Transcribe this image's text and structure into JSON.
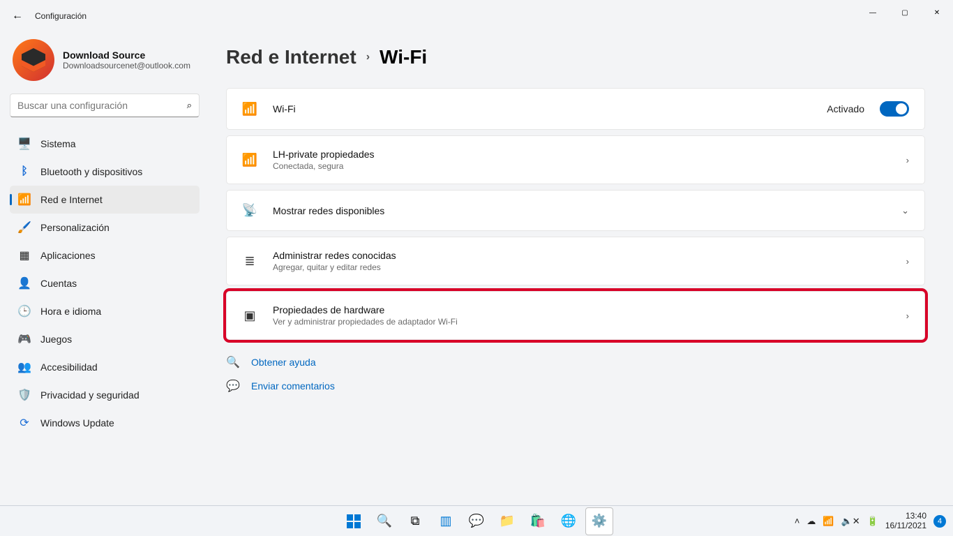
{
  "window": {
    "title": "Configuración"
  },
  "profile": {
    "name": "Download Source",
    "email": "Downloadsourcenet@outlook.com"
  },
  "search": {
    "placeholder": "Buscar una configuración"
  },
  "nav": {
    "items": [
      {
        "label": "Sistema",
        "icon": "🖥️"
      },
      {
        "label": "Bluetooth y dispositivos",
        "icon": "ᚼ"
      },
      {
        "label": "Red e Internet",
        "icon": "📶"
      },
      {
        "label": "Personalización",
        "icon": "🖌️"
      },
      {
        "label": "Aplicaciones",
        "icon": "▦"
      },
      {
        "label": "Cuentas",
        "icon": "👤"
      },
      {
        "label": "Hora e idioma",
        "icon": "🌐"
      },
      {
        "label": "Juegos",
        "icon": "🎮"
      },
      {
        "label": "Accesibilidad",
        "icon": "⏻"
      },
      {
        "label": "Privacidad y seguridad",
        "icon": "🛡️"
      },
      {
        "label": "Windows Update",
        "icon": "❖"
      }
    ],
    "activeIndex": 2
  },
  "breadcrumb": {
    "parent": "Red e Internet",
    "current": "Wi-Fi"
  },
  "wifi": {
    "toggle_label": "Wi-Fi",
    "state_label": "Activado",
    "network": {
      "title": "LH-private propiedades",
      "subtitle": "Conectada, segura"
    },
    "show_networks": "Mostrar redes disponibles",
    "known": {
      "title": "Administrar redes conocidas",
      "subtitle": "Agregar, quitar y editar redes"
    },
    "hardware": {
      "title": "Propiedades de hardware",
      "subtitle": "Ver y administrar propiedades de adaptador Wi-Fi"
    }
  },
  "links": {
    "help": "Obtener ayuda",
    "feedback": "Enviar comentarios"
  },
  "taskbar": {
    "time": "13:40",
    "date": "16/11/2021",
    "notif_count": "4"
  },
  "glyphs": {
    "back": "←",
    "min": "—",
    "max": "▢",
    "close": "✕",
    "search": "🔍",
    "chev_right": "›",
    "chev_down": "⌄",
    "wifi": "📶",
    "wifi_shield": "📶",
    "antenna": "📡",
    "list": "≣",
    "chip": "▣",
    "help": "❓",
    "feedback": "👤",
    "tray_up": "˄",
    "cloud": "☁",
    "sound": "🔈✕",
    "battery": "🔋"
  }
}
